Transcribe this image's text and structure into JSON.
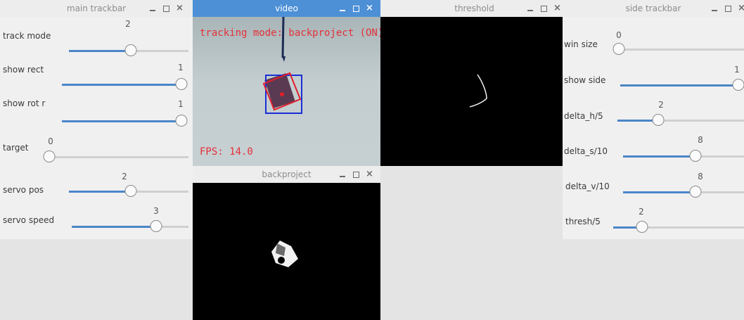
{
  "windows": {
    "main_trackbar": {
      "title": "main trackbar",
      "trackbars": [
        {
          "label": "track mode",
          "value": "2",
          "fraction": 0.52
        },
        {
          "label": "show rect",
          "value": "1",
          "fraction": 1.0
        },
        {
          "label": "show rot r",
          "value": "1",
          "fraction": 1.0
        },
        {
          "label": "target",
          "value": "0",
          "fraction": 0.0
        },
        {
          "label": "servo pos",
          "value": "2",
          "fraction": 0.52
        },
        {
          "label": "servo speed",
          "value": "3",
          "fraction": 0.72
        }
      ]
    },
    "video": {
      "title": "video",
      "overlay_text": "tracking mode: backproject (ON)",
      "fps_text": "FPS: 14.0"
    },
    "threshold": {
      "title": "threshold"
    },
    "backproject": {
      "title": "backproject"
    },
    "side_trackbar": {
      "title": "side trackbar",
      "trackbars": [
        {
          "label": "win size",
          "value": "0",
          "fraction": 0.0
        },
        {
          "label": "show side",
          "value": "1",
          "fraction": 1.0
        },
        {
          "label": "delta_h/5",
          "value": "2",
          "fraction": 0.32
        },
        {
          "label": "delta_s/10",
          "value": "8",
          "fraction": 0.6
        },
        {
          "label": "delta_v/10",
          "value": "8",
          "fraction": 0.6
        },
        {
          "label": "thresh/5",
          "value": "2",
          "fraction": 0.22
        }
      ]
    }
  },
  "icons": {
    "minimize": "minimize-icon",
    "maximize": "maximize-icon",
    "close": "close-icon"
  },
  "colors": {
    "active_title": "#4d90d6",
    "slider_fill": "#4a86c8",
    "overlay_text": "#e4303a",
    "tracking_box": "#1a2fd6",
    "rotated_box": "#e11e2d"
  }
}
